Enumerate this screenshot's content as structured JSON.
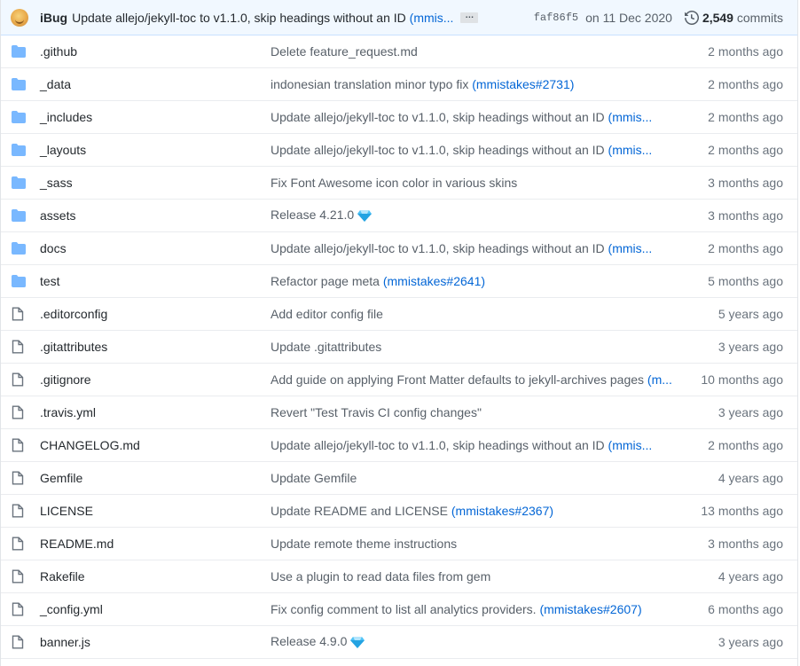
{
  "latest_commit": {
    "author": "iBug",
    "message": "Update allejo/jekyll-toc to v1.1.0, skip headings without an ID",
    "message_ref": "(mmis...",
    "sha": "faf86f5",
    "date": "on 11 Dec 2020",
    "commit_count": "2,549",
    "commit_label": "commits"
  },
  "files": [
    {
      "type": "dir",
      "name": ".github",
      "message": "Delete feature_request.md",
      "ref": "",
      "age": "2 months ago"
    },
    {
      "type": "dir",
      "name": "_data",
      "message": "indonesian translation minor typo fix ",
      "ref": "(mmistakes#2731)",
      "age": "2 months ago"
    },
    {
      "type": "dir",
      "name": "_includes",
      "message": "Update allejo/jekyll-toc to v1.1.0, skip headings without an ID ",
      "ref": "(mmis...",
      "age": "2 months ago"
    },
    {
      "type": "dir",
      "name": "_layouts",
      "message": "Update allejo/jekyll-toc to v1.1.0, skip headings without an ID ",
      "ref": "(mmis...",
      "age": "2 months ago"
    },
    {
      "type": "dir",
      "name": "_sass",
      "message": "Fix Font Awesome icon color in various skins",
      "ref": "",
      "age": "3 months ago"
    },
    {
      "type": "dir",
      "name": "assets",
      "message": "Release 4.21.0",
      "ref": "",
      "gem": true,
      "age": "3 months ago"
    },
    {
      "type": "dir",
      "name": "docs",
      "message": "Update allejo/jekyll-toc to v1.1.0, skip headings without an ID ",
      "ref": "(mmis...",
      "age": "2 months ago"
    },
    {
      "type": "dir",
      "name": "test",
      "message": "Refactor page meta ",
      "ref": "(mmistakes#2641)",
      "age": "5 months ago"
    },
    {
      "type": "file",
      "name": ".editorconfig",
      "message": "Add editor config file",
      "ref": "",
      "age": "5 years ago"
    },
    {
      "type": "file",
      "name": ".gitattributes",
      "message": "Update .gitattributes",
      "ref": "",
      "age": "3 years ago"
    },
    {
      "type": "file",
      "name": ".gitignore",
      "message": "Add guide on applying Front Matter defaults to jekyll-archives pages ",
      "ref": "(m...",
      "age": "10 months ago"
    },
    {
      "type": "file",
      "name": ".travis.yml",
      "message": "Revert \"Test Travis CI config changes\"",
      "ref": "",
      "age": "3 years ago"
    },
    {
      "type": "file",
      "name": "CHANGELOG.md",
      "message": "Update allejo/jekyll-toc to v1.1.0, skip headings without an ID ",
      "ref": "(mmis...",
      "age": "2 months ago"
    },
    {
      "type": "file",
      "name": "Gemfile",
      "message": "Update Gemfile",
      "ref": "",
      "age": "4 years ago"
    },
    {
      "type": "file",
      "name": "LICENSE",
      "message": "Update README and LICENSE ",
      "ref": "(mmistakes#2367)",
      "age": "13 months ago"
    },
    {
      "type": "file",
      "name": "README.md",
      "message": "Update remote theme instructions",
      "ref": "",
      "age": "3 months ago"
    },
    {
      "type": "file",
      "name": "Rakefile",
      "message": "Use a plugin to read data files from gem",
      "ref": "",
      "age": "4 years ago"
    },
    {
      "type": "file",
      "name": "_config.yml",
      "message": "Fix config comment to list all analytics providers. ",
      "ref": "(mmistakes#2607)",
      "age": "6 months ago"
    },
    {
      "type": "file",
      "name": "banner.js",
      "message": "Release 4.9.0",
      "ref": "",
      "gem": true,
      "age": "3 years ago"
    }
  ],
  "colors": {
    "folder": "#79b8ff",
    "link": "#0366d6",
    "muted": "#586069",
    "commit_bar_bg": "#f1f8ff"
  },
  "icons": {
    "dir": "folder-icon",
    "file": "file-icon",
    "history": "history-icon",
    "gem": "gem-icon"
  }
}
